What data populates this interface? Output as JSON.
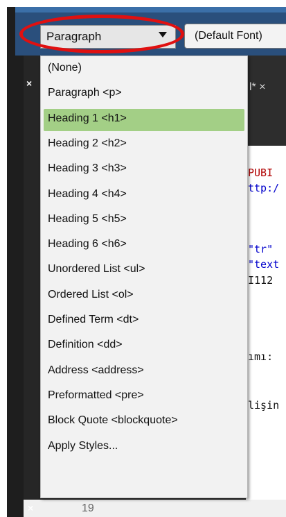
{
  "toolbar": {
    "format_value": "Paragraph",
    "font_value": "(Default Font)"
  },
  "editor": {
    "tab_label": "l* ×",
    "code_lines": [
      {
        "text": "PUBI",
        "color": "#b00000"
      },
      {
        "text": "ttp:/",
        "color": "#0000cc"
      },
      {
        "text": "\"tr\"",
        "color": "#0000cc"
      },
      {
        "text": "\"text",
        "color": "#0000cc"
      },
      {
        "text": "I112",
        "color": "#111111"
      },
      {
        "text": "ımı:",
        "color": "#111111"
      },
      {
        "text": "lişin",
        "color": "#111111"
      }
    ],
    "line_number": "19"
  },
  "dropdown": {
    "selected_index": 2,
    "items": [
      {
        "label": "(None)"
      },
      {
        "label": "Paragraph <p>"
      },
      {
        "label": "Heading 1 <h1>"
      },
      {
        "label": "Heading 2 <h2>"
      },
      {
        "label": "Heading 3 <h3>"
      },
      {
        "label": "Heading 4 <h4>"
      },
      {
        "label": "Heading 5 <h5>"
      },
      {
        "label": "Heading 6 <h6>"
      },
      {
        "label": "Unordered List <ul>"
      },
      {
        "label": "Ordered List <ol>"
      },
      {
        "label": "Defined Term <dt>"
      },
      {
        "label": "Definition <dd>"
      },
      {
        "label": "Address <address>"
      },
      {
        "label": "Preformatted <pre>"
      },
      {
        "label": "Block Quote <blockquote>"
      },
      {
        "label": "Apply Styles..."
      }
    ]
  },
  "colors": {
    "selected_bg": "#a3cf86",
    "annotation_red": "#e01010",
    "toolbar_blue": "#2a4f7c"
  },
  "icons": {
    "close": "close-icon",
    "dropdown_arrow": "chevron-down-icon"
  }
}
